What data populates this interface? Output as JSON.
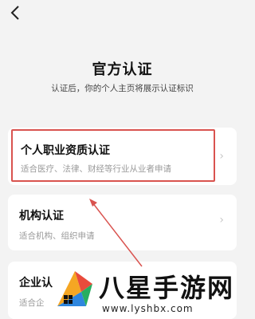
{
  "header": {
    "back_icon": "chevron-left-icon"
  },
  "page": {
    "title": "官方认证",
    "subtitle": "认证后，你的个人主页将展示认证标识"
  },
  "cards": [
    {
      "title": "个人职业资质认证",
      "desc": "适合医疗、法律、财经等行业从业者申请"
    },
    {
      "title": "机构认证",
      "desc": "适合机构、组织申请"
    },
    {
      "title": "企业认",
      "desc": "适合企"
    }
  ],
  "annotation": {
    "highlight_color": "#d9534f"
  },
  "watermark": {
    "name": "八星手游网",
    "url": "www.lyshbx.com"
  }
}
